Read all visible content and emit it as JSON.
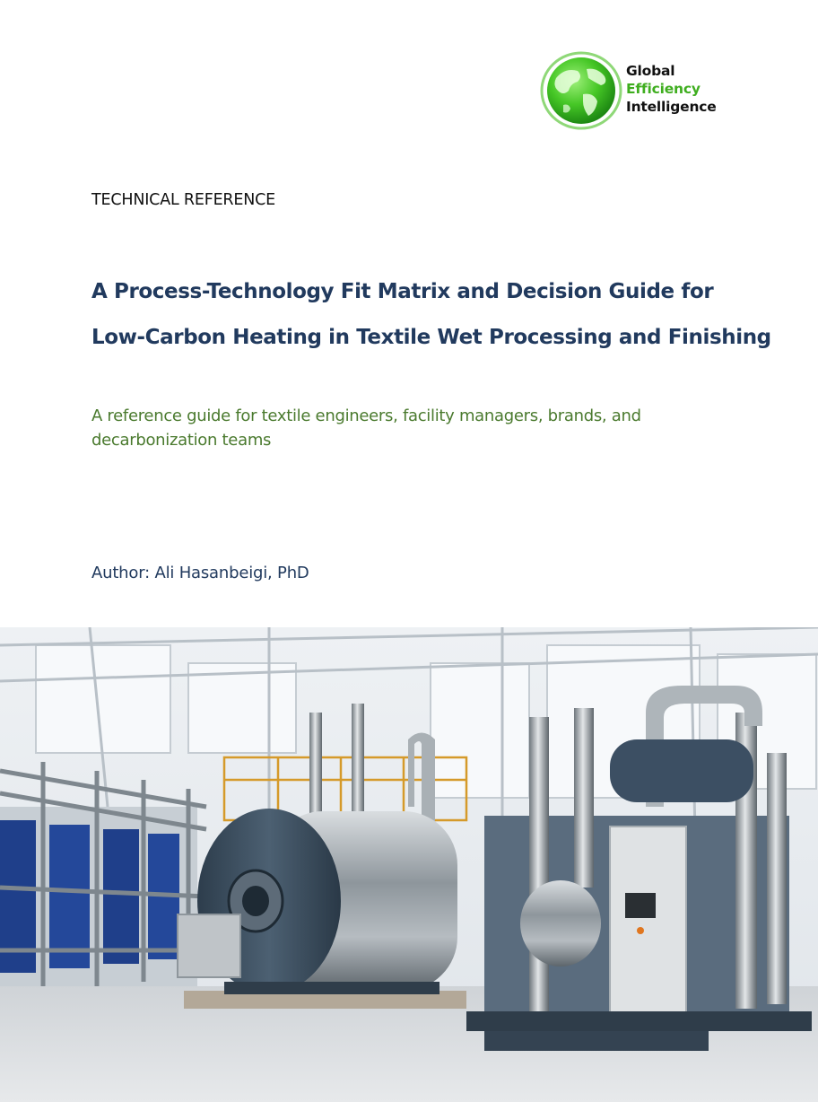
{
  "logo": {
    "line1": "Global",
    "line2": "Efficiency",
    "line3": "Intelligence",
    "icon": "green-globe-icon",
    "colors": {
      "primary_text": "#111111",
      "accent": "#3fae1f"
    }
  },
  "doc_type": "TECHNICAL REFERENCE",
  "title": {
    "line1": "A Process-Technology Fit Matrix and Decision Guide for",
    "line2": "Low-Carbon Heating in Textile Wet Processing and Finishing"
  },
  "subtitle": {
    "line1": "A reference guide for textile engineers, facility managers, brands, and",
    "line2": "decarbonization teams"
  },
  "author": "Author: Ali Hasanbeigi, PhD",
  "cover_image": "industrial-boiler-heat-pump-photo",
  "colors": {
    "title": "#213a5e",
    "subtitle": "#4a7a2e",
    "author": "#213a5e"
  }
}
